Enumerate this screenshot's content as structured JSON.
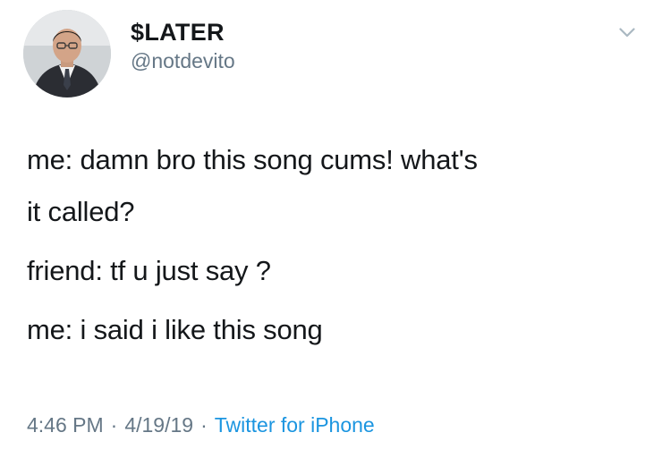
{
  "author": {
    "display_name": "$LATER",
    "handle": "@notdevito"
  },
  "icons": {
    "avatar": "avatar-photo",
    "more": "chevron-down-icon"
  },
  "tweet": {
    "lines": [
      "me: damn bro this song cums! what's",
      "it called?",
      "friend: tf u just say ?",
      "me: i said i like this song"
    ]
  },
  "meta": {
    "time": "4:46 PM",
    "date": "4/19/19",
    "separator": "·",
    "source": "Twitter for iPhone"
  },
  "colors": {
    "text": "#14171a",
    "secondary": "#657786",
    "link": "#1b95e0"
  }
}
